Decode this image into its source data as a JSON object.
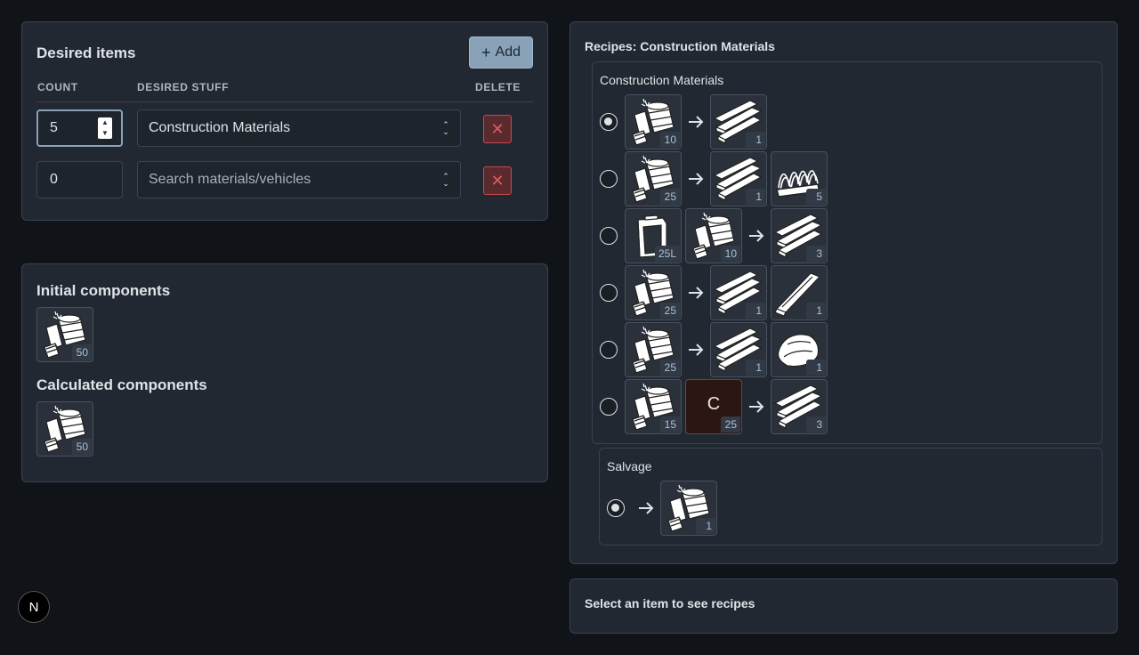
{
  "desired": {
    "title": "Desired items",
    "add_label": "Add",
    "headers": {
      "count": "COUNT",
      "stuff": "DESIRED STUFF",
      "delete": "DELETE"
    },
    "rows": [
      {
        "count": "5",
        "stuff": "Construction Materials",
        "placeholder": ""
      },
      {
        "count": "0",
        "stuff": "",
        "placeholder": "Search materials/vehicles"
      }
    ]
  },
  "components": {
    "initial_title": "Initial components",
    "initial_qty": "50",
    "calculated_title": "Calculated components",
    "calculated_qty": "50"
  },
  "recipes": {
    "title": "Recipes: Construction Materials",
    "group1": {
      "name": "Construction Materials",
      "rows": [
        {
          "inputs": [
            "10"
          ],
          "outputs": [
            "1"
          ]
        },
        {
          "inputs": [
            "25"
          ],
          "outputs": [
            "1",
            "5"
          ]
        },
        {
          "inputs": [
            "25L",
            "10"
          ],
          "outputs": [
            "3"
          ]
        },
        {
          "inputs": [
            "25"
          ],
          "outputs": [
            "1",
            "1"
          ]
        },
        {
          "inputs": [
            "25"
          ],
          "outputs": [
            "1",
            "1"
          ]
        },
        {
          "inputs": [
            "15",
            "25"
          ],
          "outputs": [
            "3"
          ],
          "letter": "C"
        }
      ]
    },
    "group2": {
      "name": "Salvage",
      "qty": "1"
    }
  },
  "select_hint": "Select an item to see recipes",
  "badge": "N",
  "colors": {
    "accent": "#8aa2b8",
    "danger": "#c9474d",
    "panel": "#222831",
    "bg": "#101318"
  }
}
